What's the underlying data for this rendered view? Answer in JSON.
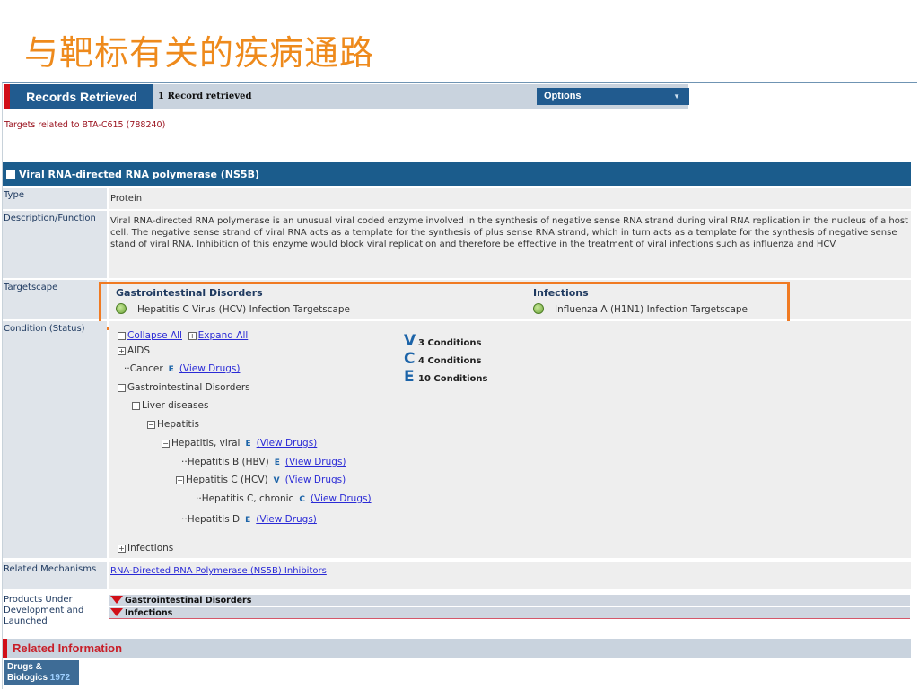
{
  "slide_title": "与靶标有关的疾病通路",
  "records": {
    "title": "Records Retrieved",
    "count": "1 Record retrieved",
    "options_label": "Options"
  },
  "targets_line": "Targets related to BTA-C615 (788240)",
  "target": {
    "name": "Viral RNA-directed RNA polymerase (NS5B)",
    "type_label": "Type",
    "type_value": "Protein",
    "desc_label": "Description/Function",
    "desc_value": "Viral RNA-directed RNA polymerase is an unusual viral coded enzyme involved in the synthesis of negative sense RNA strand during viral RNA replication in the nucleus of a host cell. The negative sense strand of viral RNA acts as a template for the synthesis of plus sense RNA strand, which in turn acts as a template for the synthesis of negative sense stand of viral RNA. Inhibition of this enzyme would block viral replication and therefore be effective in the treatment of viral infections such as influenza and HCV.",
    "targetscape_label": "Targetscape",
    "targetscape": [
      {
        "heading": "Gastrointestinal Disorders",
        "item": "Hepatitis C Virus (HCV) Infection Targetscape"
      },
      {
        "heading": "Infections",
        "item": "Influenza A (H1N1) Infection Targetscape"
      }
    ],
    "condition_label": "Condition (Status)",
    "collapse_all": "Collapse All",
    "expand_all": "Expand All",
    "legend": [
      {
        "code": "V",
        "text": "3 Conditions"
      },
      {
        "code": "C",
        "text": "4 Conditions"
      },
      {
        "code": "E",
        "text": "10 Conditions"
      }
    ],
    "tree": {
      "aids": "AIDS",
      "cancer": "Cancer",
      "cancer_code": "E",
      "gi": "Gastrointestinal Disorders",
      "liver": "Liver diseases",
      "hepatitis": "Hepatitis",
      "hep_viral": "Hepatitis, viral",
      "hep_viral_code": "E",
      "hep_b": "Hepatitis B (HBV)",
      "hep_b_code": "E",
      "hep_c": "Hepatitis C (HCV)",
      "hep_c_code": "V",
      "hep_c_chronic": "Hepatitis C, chronic",
      "hep_c_chronic_code": "C",
      "hep_d": "Hepatitis D",
      "hep_d_code": "E",
      "infections": "Infections",
      "view_drugs": "(View Drugs)"
    },
    "mechanisms_label": "Related Mechanisms",
    "mechanisms_value": "RNA-Directed RNA Polymerase (NS5B) Inhibitors",
    "products_label": "Products Under Development and Launched",
    "products": [
      "Gastrointestinal Disorders",
      "Infections"
    ]
  },
  "related_info": "Related Information",
  "db_logo": {
    "line1": "Drugs &",
    "line2": "Biologics",
    "year": "1972"
  },
  "colors": {
    "accent": "#ee8a1c",
    "header_blue": "#1b5c8c",
    "brand_red": "#d10f18",
    "highlight": "#f07a22"
  }
}
